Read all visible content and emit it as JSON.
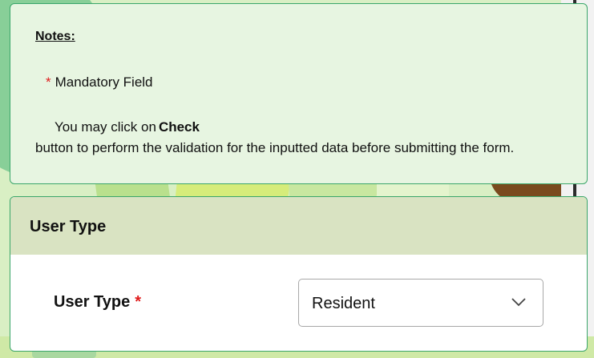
{
  "notes": {
    "title": "Notes:",
    "mandatory_star": "*",
    "mandatory_text": "Mandatory Field",
    "check_prefix": "You may click on",
    "check_keyword": "Check",
    "check_suffix": "button to perform the validation for the inputted data before submitting the form."
  },
  "user_type_section": {
    "header": "User Type",
    "field_label": "User Type",
    "required_star": "*",
    "select_value": "Resident",
    "select_icon": "chevron-down-icon"
  },
  "colors": {
    "panel_border": "#3aa66a",
    "notes_bg": "#e7f5e1",
    "section_header_bg": "#d9e3c2",
    "required": "#e01b1b"
  }
}
